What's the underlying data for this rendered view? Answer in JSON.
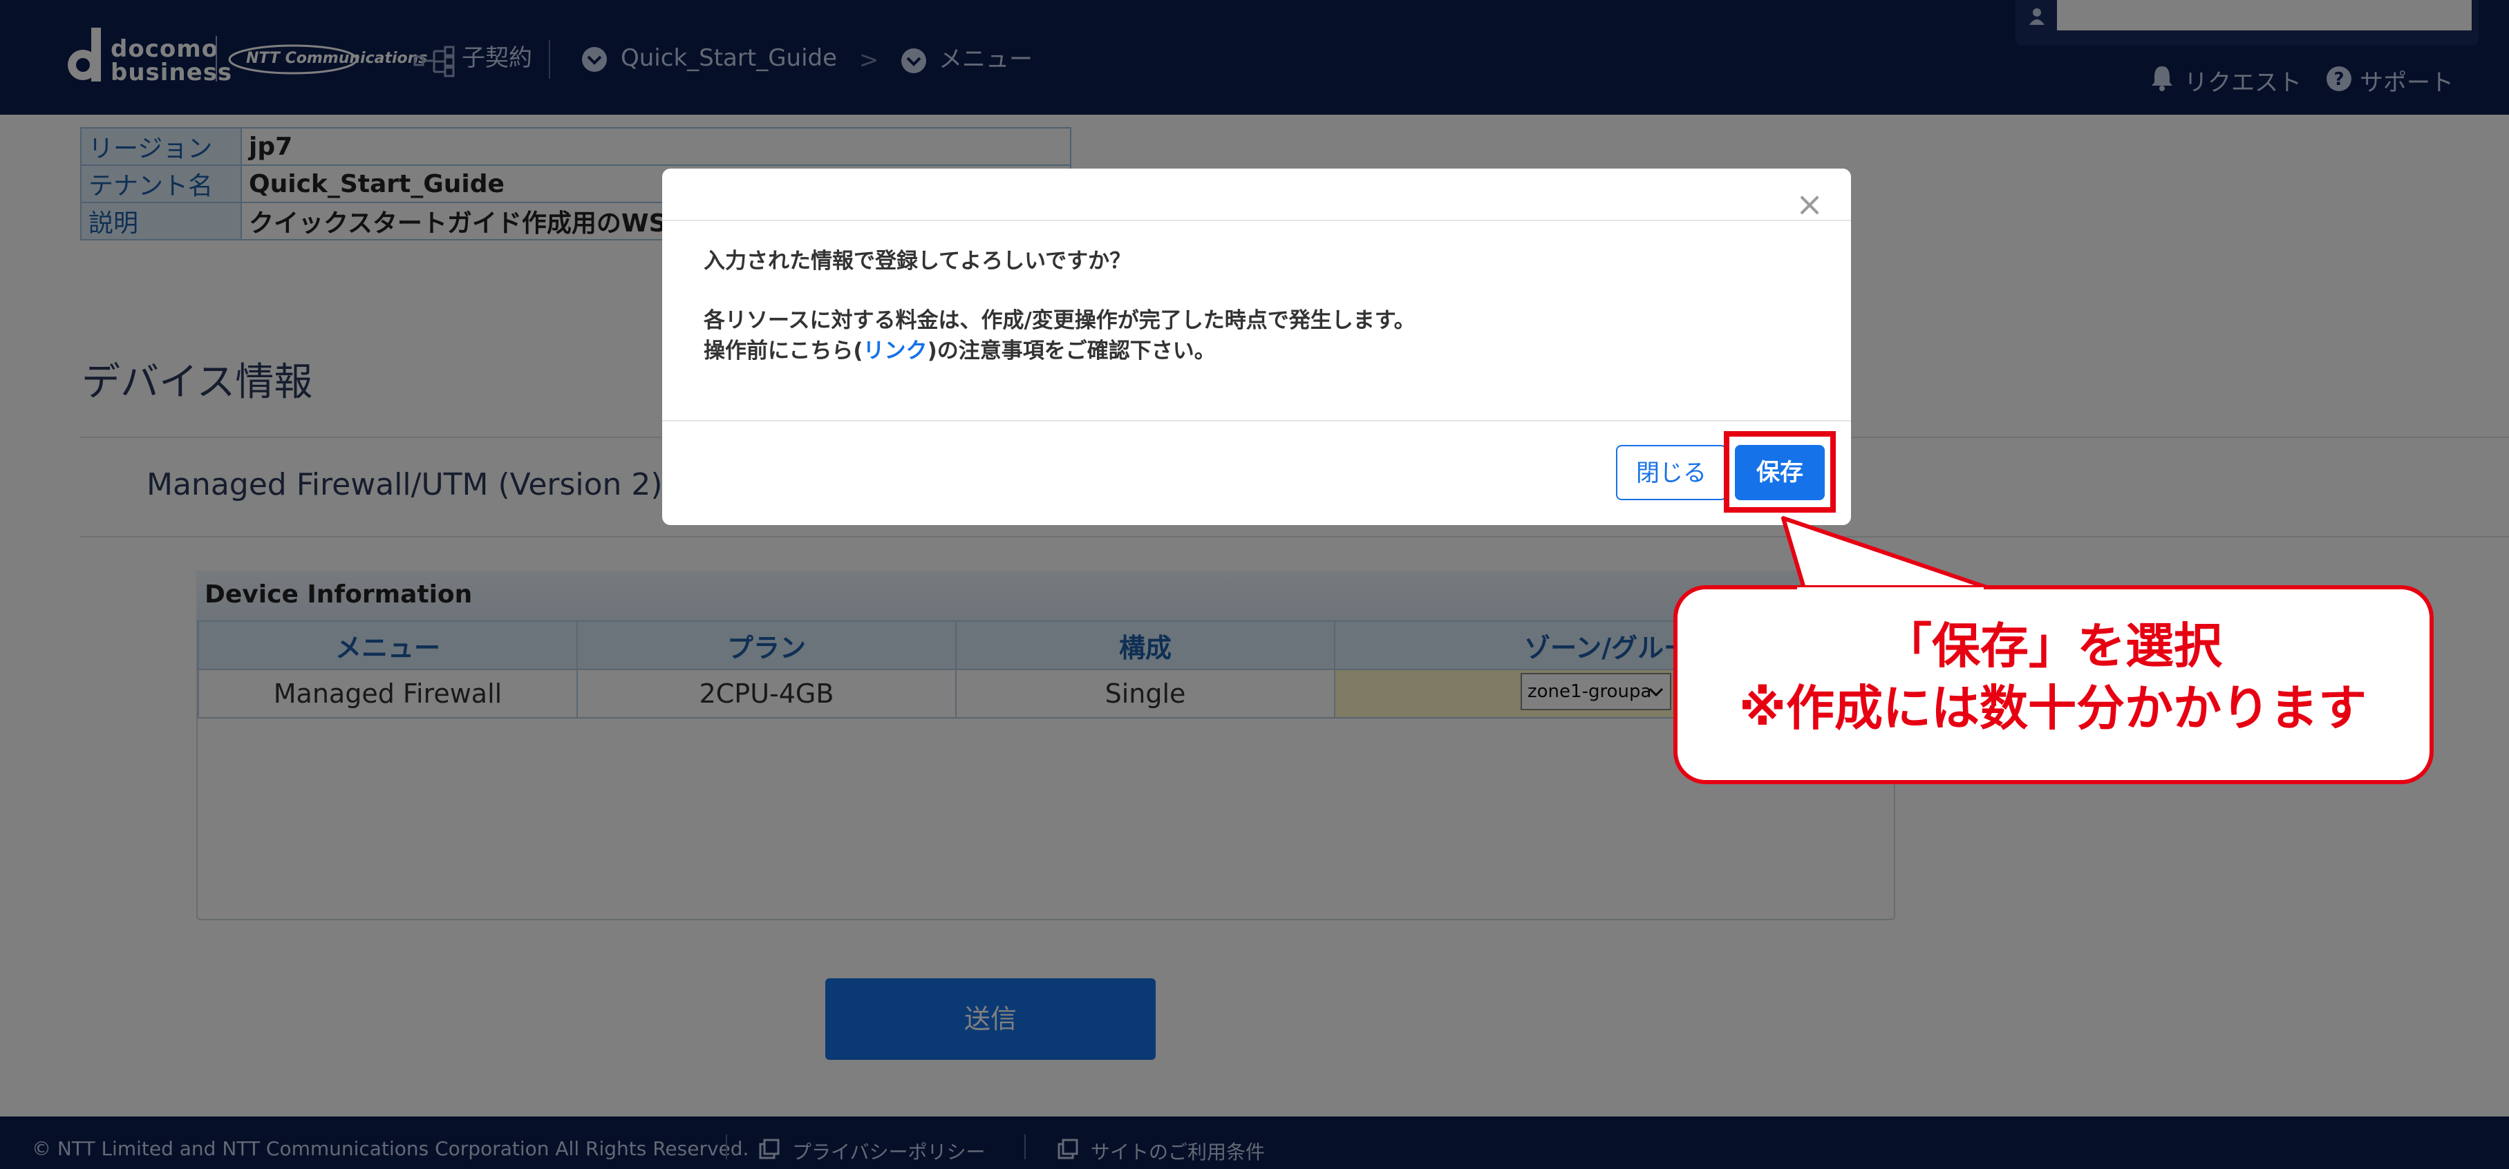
{
  "header": {
    "brand_line1": "docomo",
    "brand_line2": "business",
    "ntt_logo_text": "NTT Communications",
    "contract_label": "子契約",
    "tenant_selector_label": "Quick_Start_Guide",
    "breadcrumb_separator": ">",
    "menu_selector_label": "メニュー",
    "request_label": "リクエスト",
    "support_label": "サポート",
    "user_field_value": ""
  },
  "info": {
    "rows": [
      {
        "key": "リージョン",
        "value": "jp7"
      },
      {
        "key": "テナント名",
        "value": "Quick_Start_Guide"
      },
      {
        "key": "説明",
        "value": "クイックスタートガイド作成用のWS"
      }
    ]
  },
  "main": {
    "section_title": "デバイス情報",
    "sub_title": "Managed Firewall/UTM (Version 2)",
    "device_panel_title": "Device Information",
    "columns": [
      "メニュー",
      "プラン",
      "構成",
      "ゾーン/グループ"
    ],
    "row": {
      "menu": "Managed Firewall",
      "plan": "2CPU-4GB",
      "config": "Single",
      "zone_select": "zone1-groupa"
    },
    "send_button": "送信"
  },
  "footer": {
    "copyright": "© NTT Limited and NTT Communications Corporation All Rights Reserved.",
    "privacy_link": "プライバシーポリシー",
    "terms_link": "サイトのご利用条件"
  },
  "modal": {
    "close_symbol": "×",
    "question": "入力された情報で登録してよろしいですか？",
    "notice_line1": "各リソースに対する料金は、作成/変更操作が完了した時点で発生します。",
    "notice_line2_before": "操作前にこちら(",
    "notice_link": "リンク",
    "notice_line2_after": ")の注意事項をご確認下さい。",
    "close_button": "閉じる",
    "save_button": "保存"
  },
  "callout": {
    "line1": "「保存」を選択",
    "line2": "※作成には数十分かかります",
    "color": "#e60012"
  },
  "colors": {
    "header_bg": "#0b1e50",
    "primary": "#1672e8"
  }
}
